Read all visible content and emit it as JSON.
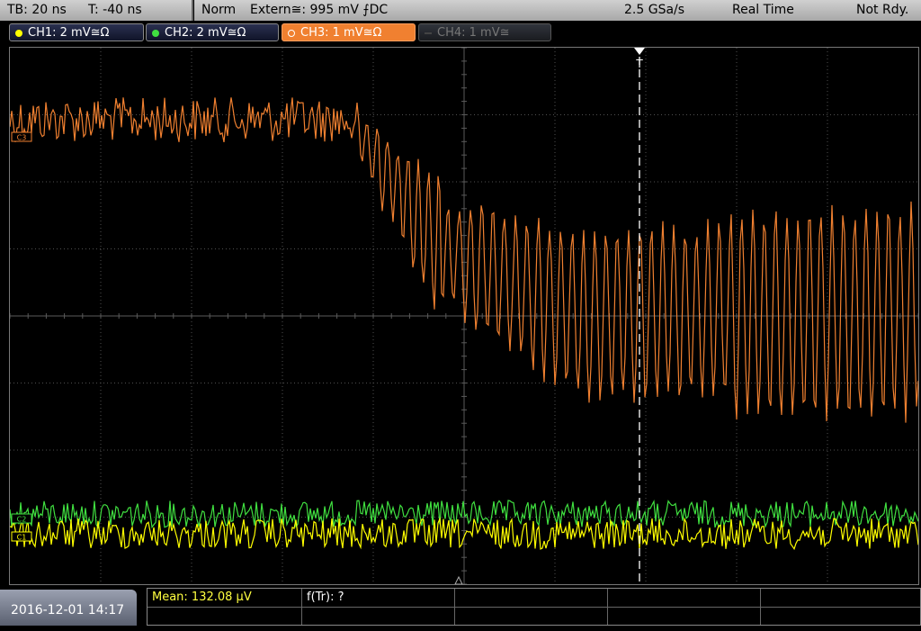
{
  "top_bar": {
    "timebase": "TB: 20 ns",
    "trigger_time": "T: -40 ns",
    "mode": "Norm",
    "source": "Extern≅: 995 mV ⨍DC",
    "sample_rate": "2.5 GSa/s",
    "acquisition": "Real Time",
    "status": "Not Rdy."
  },
  "channels": [
    {
      "label": "CH1: 2 mV≅Ω",
      "color": "#ffff00",
      "state": "on"
    },
    {
      "label": "CH2: 2 mV≅Ω",
      "color": "#40e040",
      "state": "on"
    },
    {
      "label": "CH3: 1 mV≅Ω",
      "color": "#f08030",
      "state": "selected"
    },
    {
      "label": "CH4: 1 mV≅",
      "color": "#777777",
      "state": "off"
    }
  ],
  "markers": {
    "ch1": "C1",
    "ch2": "C2",
    "ch3": "C3",
    "trigger": "T"
  },
  "colors": {
    "ch1": "#ffff00",
    "ch2": "#40e040",
    "ch3": "#f08030",
    "grid": "#505050"
  },
  "bottom": {
    "datetime": "2016-12-01 14:17",
    "measurements": [
      {
        "label": "Mean: 132.08 µV",
        "color": "#ffff40"
      },
      {
        "label": "f(Tr): ?",
        "color": "#ffffff"
      }
    ]
  }
}
